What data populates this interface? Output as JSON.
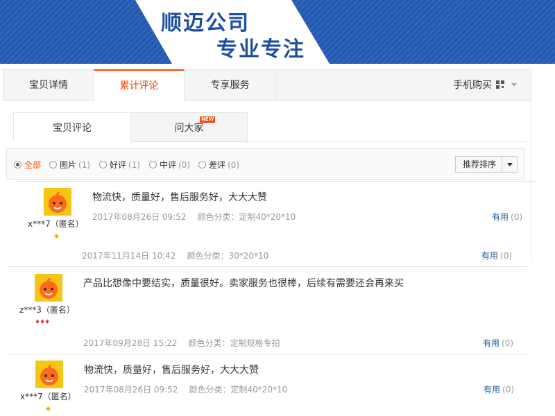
{
  "banner": {
    "line1": "顺迈公司",
    "line2": "专业专注"
  },
  "main_tabs": [
    "宝贝详情",
    "累计评论",
    "专享服务"
  ],
  "mobile_buy": "手机购买",
  "sub_tabs": {
    "items": [
      "宝贝评论",
      "问大家"
    ],
    "badge": "NEW"
  },
  "filters": [
    {
      "label": "全部",
      "count": ""
    },
    {
      "label": "图片",
      "count": "(1)"
    },
    {
      "label": "好评",
      "count": "(1)"
    },
    {
      "label": "中评",
      "count": "(0)"
    },
    {
      "label": "差评",
      "count": "(0)"
    }
  ],
  "sort_label": "推荐排序",
  "reviews": [
    {
      "user": "x***7（匿名）",
      "rank": "◆",
      "content": "物流快，质量好，售后服务好，大大大赞",
      "date": "2017年08月26日 09:52",
      "spec": "颜色分类：定制40*20*10",
      "useful": "有用",
      "useful_count": "(0)"
    },
    {
      "user": "",
      "rank": "",
      "content": "",
      "date": "2017年11月14日 10:42",
      "spec": "颜色分类：30*20*10",
      "useful": "有用",
      "useful_count": "(0)"
    },
    {
      "user": "z***3（匿名）",
      "rank": "♦♦♦",
      "content": "产品比想像中要结实，质量很好。卖家服务也很棒，后续有需要还会再来买",
      "date": "2017年09月28日 15:22",
      "spec": "颜色分类：定制规格专拍",
      "useful": "有用",
      "useful_count": "(0)"
    },
    {
      "user": "x***7（匿名）",
      "rank": "◆",
      "content": "物流快，质量好，售后服务好，大大大赞",
      "date": "2017年08月26日 09:52",
      "spec": "颜色分类：定制40*20*10",
      "useful": "有用",
      "useful_count": "(0)"
    }
  ],
  "colors": {
    "accent": "#ff4400",
    "banner_blue": "#2a62b8",
    "link": "#1d5aa0"
  }
}
